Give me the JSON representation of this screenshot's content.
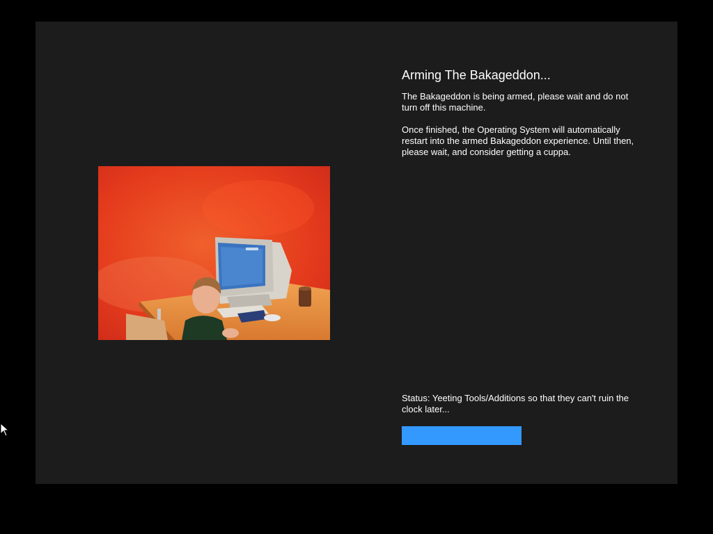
{
  "setup": {
    "title": "Arming The Bakageddon...",
    "paragraph_1": "The Bakageddon is being armed, please wait and do not turn off this machine.",
    "paragraph_2": "Once finished, the Operating System will automatically restart into the armed Bakageddon experience. Until then, please wait, and consider getting a cuppa.",
    "status": "Status: Yeeting Tools/Additions so that they can't ruin the clock later...",
    "progress_fraction": 1.0,
    "image_icon": "toddler-at-computer-photo",
    "cursor_icon": "mouse-pointer-icon"
  },
  "colors": {
    "screen_bg": "#000000",
    "panel_bg": "#1c1c1c",
    "text": "#ffffff",
    "progress_fill": "#3399ff"
  }
}
